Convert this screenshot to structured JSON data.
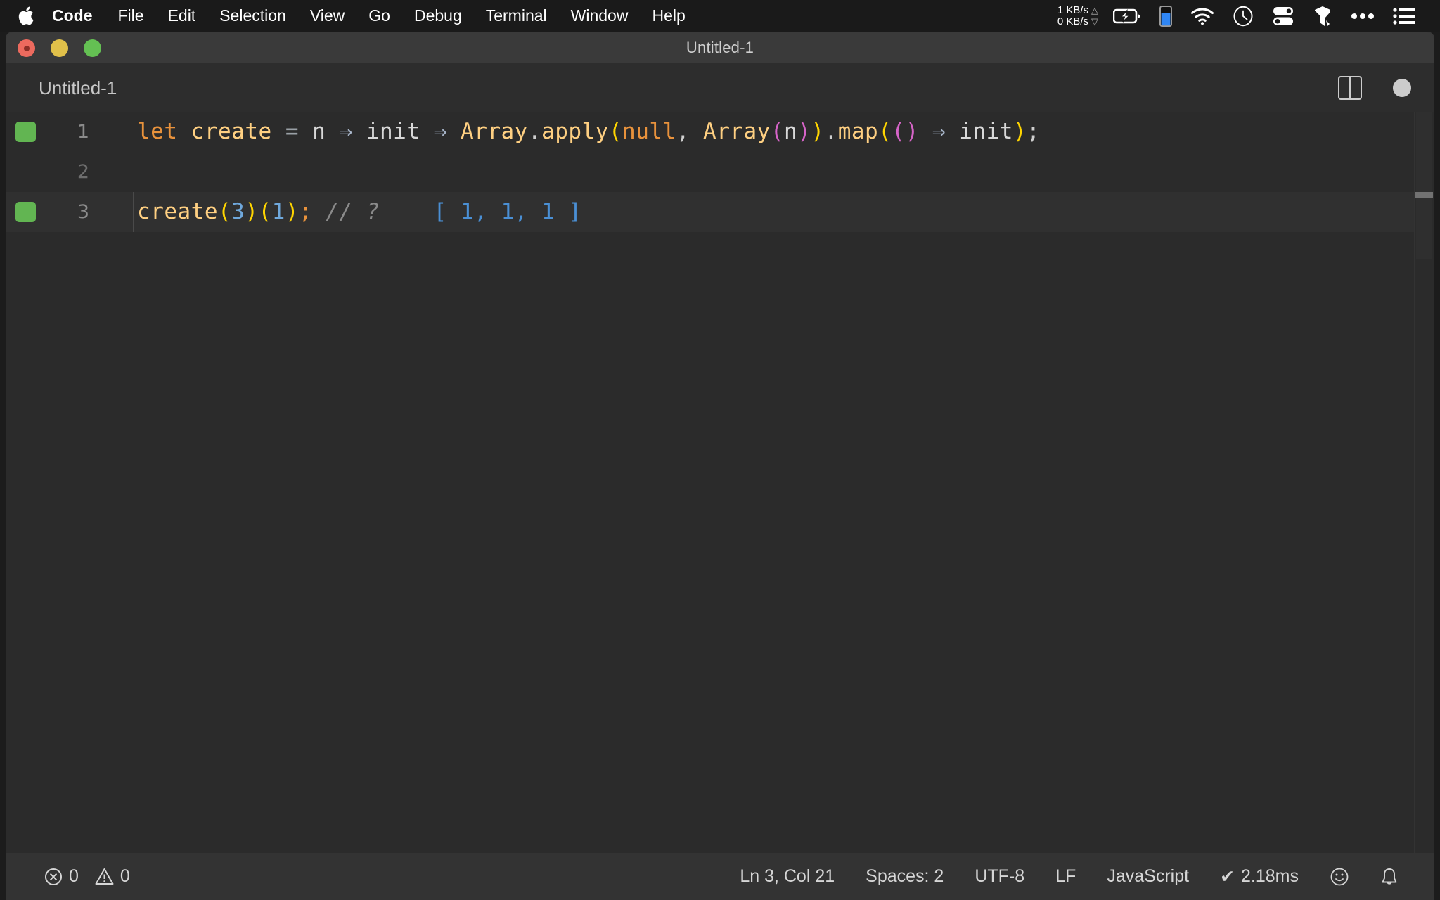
{
  "menubar": {
    "apple_icon": "apple-logo-icon",
    "items": [
      {
        "label": "Code",
        "bold": true
      },
      {
        "label": "File",
        "bold": false
      },
      {
        "label": "Edit",
        "bold": false
      },
      {
        "label": "Selection",
        "bold": false
      },
      {
        "label": "View",
        "bold": false
      },
      {
        "label": "Go",
        "bold": false
      },
      {
        "label": "Debug",
        "bold": false
      },
      {
        "label": "Terminal",
        "bold": false
      },
      {
        "label": "Window",
        "bold": false
      },
      {
        "label": "Help",
        "bold": false
      }
    ],
    "network": {
      "upload": "1 KB/s",
      "download": "0 KB/s",
      "up_arrow": "△",
      "down_arrow": "▽"
    },
    "status_icons": [
      "battery-charging-icon",
      "gauge-bar-icon",
      "wifi-icon",
      "clock-icon",
      "toggles-icon",
      "shield-icon",
      "ellipsis-icon",
      "list-menu-icon"
    ]
  },
  "window": {
    "title": "Untitled-1",
    "controls": {
      "close": "close-button",
      "minimize": "minimize-button",
      "maximize": "maximize-button"
    }
  },
  "tabbar": {
    "tab_label": "Untitled-1",
    "split_editor_icon": "split-editor-icon",
    "unsaved_indicator": "unsaved-dot-icon"
  },
  "editor": {
    "language": "JavaScript",
    "lines": [
      {
        "number": "1",
        "marker": "ok",
        "active": false,
        "tokens": [
          {
            "text": "let",
            "cls": "t-key"
          },
          {
            "text": " ",
            "cls": "t-var"
          },
          {
            "text": "create",
            "cls": "t-fn"
          },
          {
            "text": " ",
            "cls": "t-var"
          },
          {
            "text": "=",
            "cls": "t-op"
          },
          {
            "text": " ",
            "cls": "t-var"
          },
          {
            "text": "n",
            "cls": "t-var"
          },
          {
            "text": " ",
            "cls": "t-var"
          },
          {
            "text": "⇒",
            "cls": "t-arrow"
          },
          {
            "text": " ",
            "cls": "t-var"
          },
          {
            "text": "init",
            "cls": "t-var"
          },
          {
            "text": " ",
            "cls": "t-var"
          },
          {
            "text": "⇒",
            "cls": "t-arrow"
          },
          {
            "text": " ",
            "cls": "t-var"
          },
          {
            "text": "Array",
            "cls": "t-fn"
          },
          {
            "text": ".",
            "cls": "t-punc"
          },
          {
            "text": "apply",
            "cls": "t-fn"
          },
          {
            "text": "(",
            "cls": "t-p1"
          },
          {
            "text": "null",
            "cls": "t-const"
          },
          {
            "text": ",",
            "cls": "t-punc"
          },
          {
            "text": " ",
            "cls": "t-var"
          },
          {
            "text": "Array",
            "cls": "t-fn"
          },
          {
            "text": "(",
            "cls": "t-p2"
          },
          {
            "text": "n",
            "cls": "t-var"
          },
          {
            "text": ")",
            "cls": "t-p2"
          },
          {
            "text": ")",
            "cls": "t-p1"
          },
          {
            "text": ".",
            "cls": "t-punc"
          },
          {
            "text": "map",
            "cls": "t-fn"
          },
          {
            "text": "(",
            "cls": "t-p1"
          },
          {
            "text": "(",
            "cls": "t-p2"
          },
          {
            "text": ")",
            "cls": "t-p2"
          },
          {
            "text": " ",
            "cls": "t-var"
          },
          {
            "text": "⇒",
            "cls": "t-arrow"
          },
          {
            "text": " ",
            "cls": "t-var"
          },
          {
            "text": "init",
            "cls": "t-var"
          },
          {
            "text": ")",
            "cls": "t-p1"
          },
          {
            "text": ";",
            "cls": "t-punc"
          }
        ],
        "plain": "let create = n ⇒ init ⇒ Array.apply(null, Array(n)).map(() ⇒ init);"
      },
      {
        "number": "2",
        "marker": "none",
        "active": false,
        "tokens": [],
        "plain": ""
      },
      {
        "number": "3",
        "marker": "ok",
        "active": true,
        "tokens": [
          {
            "text": "create",
            "cls": "t-fn"
          },
          {
            "text": "(",
            "cls": "t-p1"
          },
          {
            "text": "3",
            "cls": "t-num"
          },
          {
            "text": ")",
            "cls": "t-p1"
          },
          {
            "text": "(",
            "cls": "t-p1"
          },
          {
            "text": "1",
            "cls": "t-num"
          },
          {
            "text": ")",
            "cls": "t-p1"
          },
          {
            "text": ";",
            "cls": "t-semi"
          },
          {
            "text": " ",
            "cls": "t-var"
          },
          {
            "text": "// ?",
            "cls": "t-cmt"
          },
          {
            "text": "    ",
            "cls": "t-var"
          },
          {
            "text": "[ 1, 1, 1 ]",
            "cls": "t-res"
          }
        ],
        "plain": "create(3)(1); // ?    [ 1, 1, 1 ]"
      }
    ],
    "inline_result": "[ 1, 1, 1 ]"
  },
  "statusbar": {
    "errors": {
      "icon": "error-circle-icon",
      "count": "0"
    },
    "warnings": {
      "icon": "warning-triangle-icon",
      "count": "0"
    },
    "cursor_position": "Ln 3, Col 21",
    "indentation": "Spaces: 2",
    "encoding": "UTF-8",
    "eol": "LF",
    "language_mode": "JavaScript",
    "runtime": {
      "check": "✔",
      "label": "2.18ms"
    },
    "feedback_icon": "smiley-icon",
    "notifications_icon": "bell-icon"
  },
  "colors": {
    "menubar_bg": "#1a1a1a",
    "titlebar_bg": "#3a3a3a",
    "editor_bg": "#2b2b2b",
    "statusbar_bg": "#333333",
    "accent_green": "#62b552",
    "result_blue": "#4a8fd4",
    "keyword_orange": "#e8923c",
    "function_yellow": "#ffd082",
    "bracket_yellow": "#ffd500",
    "bracket_magenta": "#d664c8"
  }
}
